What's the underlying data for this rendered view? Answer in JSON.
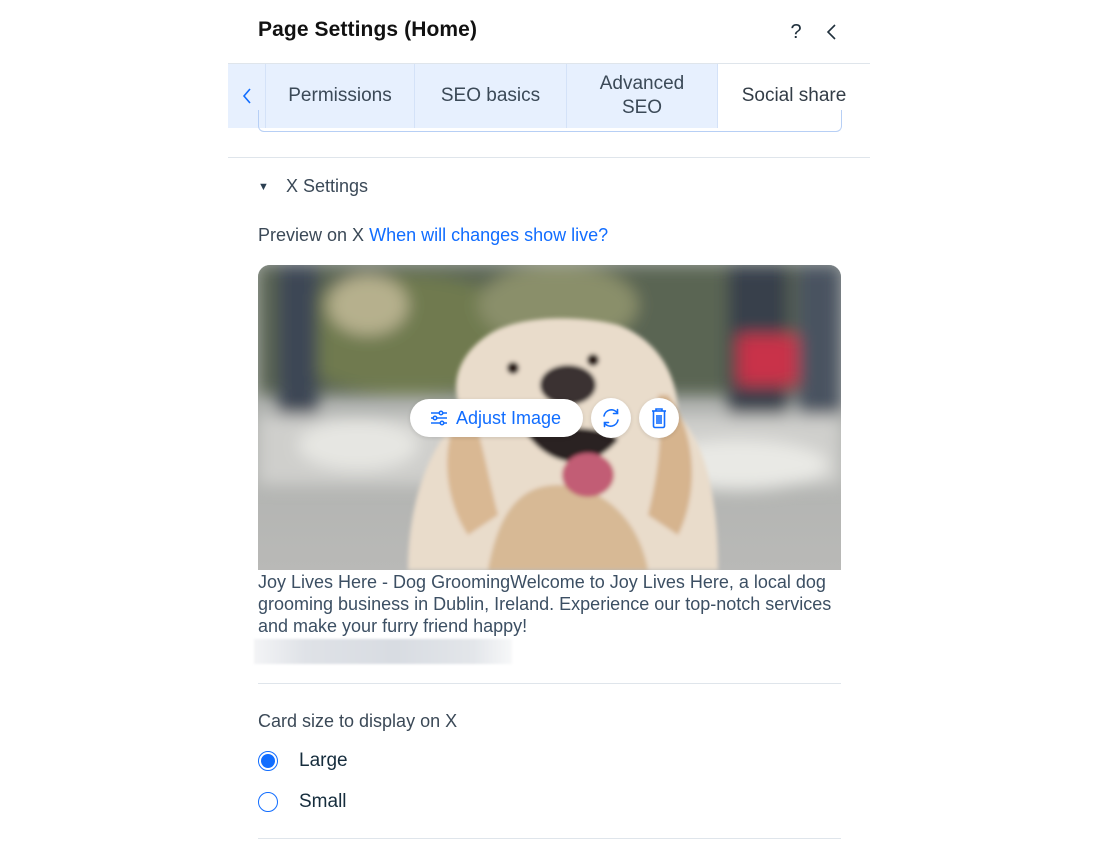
{
  "header": {
    "title": "Page Settings (Home)",
    "help_label": "?",
    "help_icon": "question-mark-icon",
    "back_icon": "chevron-left-icon"
  },
  "tabs": {
    "scroll_left_icon": "chevron-left-icon",
    "items": [
      {
        "label": "Permissions",
        "active": false
      },
      {
        "label": "SEO basics",
        "active": false
      },
      {
        "label": "Advanced SEO",
        "active": false
      },
      {
        "label": "Social share",
        "active": true
      }
    ]
  },
  "x_settings": {
    "section_title": "X Settings",
    "expanded": true,
    "preview_label": "Preview on X",
    "preview_link": "When will changes show live?",
    "image_actions": {
      "adjust_label": "Adjust Image",
      "adjust_icon": "sliders-icon",
      "replace_icon": "refresh-icon",
      "delete_icon": "trash-icon"
    },
    "card_text": "Joy Lives Here - Dog GroomingWelcome to Joy Lives Here, a local dog grooming business in Dublin, Ireland. Experience our top-notch services and make your furry friend happy!",
    "card_size": {
      "label": "Card size to display on X",
      "options": [
        {
          "label": "Large",
          "selected": true
        },
        {
          "label": "Small",
          "selected": false
        }
      ]
    }
  },
  "colors": {
    "accent": "#116dff",
    "tab_background": "#e7f0fe",
    "text_primary": "#162d3d",
    "text_secondary": "#3b4957",
    "divider": "#dfe5eb"
  }
}
